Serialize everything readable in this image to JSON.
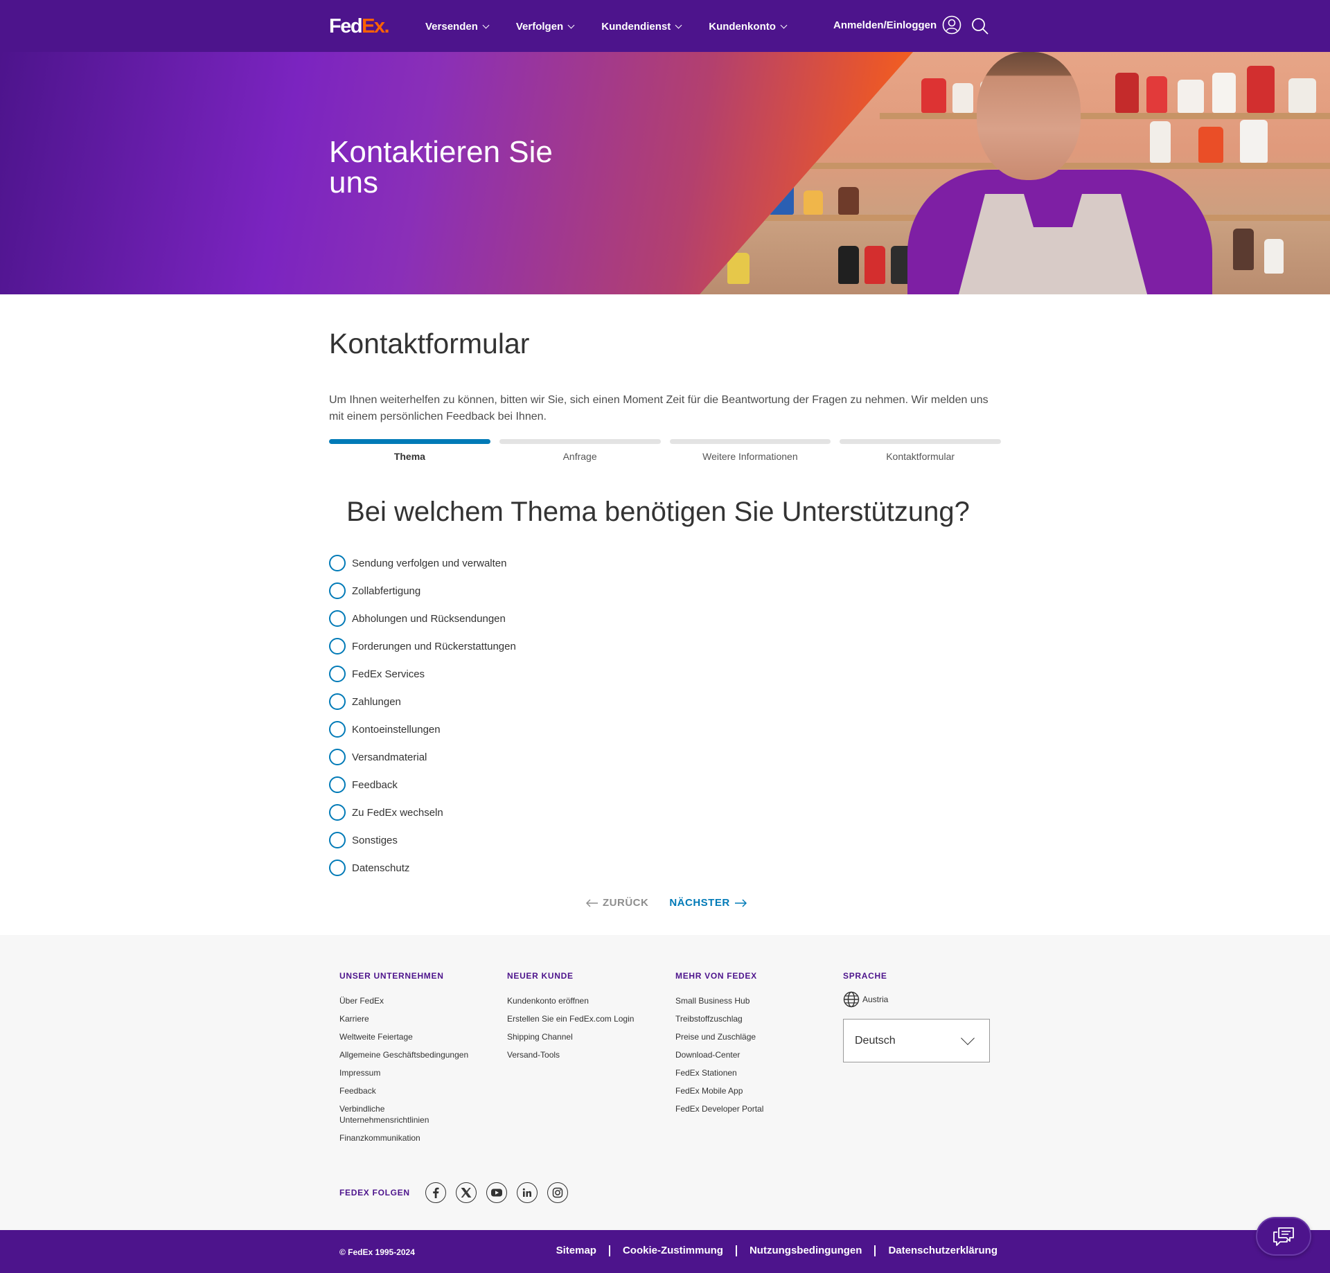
{
  "header": {
    "logo_fed": "Fed",
    "logo_ex": "Ex",
    "logo_dot": ".",
    "nav": [
      "Versenden",
      "Verfolgen",
      "Kundendienst",
      "Kundenkonto"
    ],
    "login_label": "Anmelden/Einloggen"
  },
  "hero": {
    "title": "Kontaktieren Sie uns"
  },
  "main": {
    "title": "Kontaktformular",
    "intro": "Um Ihnen weiterhelfen zu können, bitten wir Sie, sich einen Moment Zeit für die Beantwortung der Fragen zu nehmen. Wir melden uns mit einem persönlichen Feedback bei Ihnen.",
    "steps": [
      "Thema",
      "Anfrage",
      "Weitere Informationen",
      "Kontaktformular"
    ],
    "active_step": 0,
    "question": "Bei welchem Thema benötigen Sie Unterstützung?",
    "options": [
      "Sendung verfolgen und verwalten",
      "Zollabfertigung",
      "Abholungen und Rücksendungen",
      "Forderungen und Rückerstattungen",
      "FedEx Services",
      "Zahlungen",
      "Kontoeinstellungen",
      "Versandmaterial",
      "Feedback",
      "Zu FedEx wechseln",
      "Sonstiges",
      "Datenschutz"
    ],
    "back_label": "ZURÜCK",
    "next_label": "NÄCHSTER"
  },
  "footer": {
    "col1": {
      "heading": "UNSER UNTERNEHMEN",
      "links": [
        "Über FedEx",
        "Karriere",
        "Weltweite Feiertage",
        "Allgemeine Geschäftsbedingungen",
        "Impressum",
        "Feedback",
        "Verbindliche Unternehmensrichtlinien",
        "Finanzkommunikation"
      ]
    },
    "col2": {
      "heading": "NEUER KUNDE",
      "links": [
        "Kundenkonto eröffnen",
        "Erstellen Sie ein FedEx.com Login",
        "Shipping Channel",
        "Versand-Tools"
      ]
    },
    "col3": {
      "heading": "MEHR VON FEDEX",
      "links": [
        "Small Business Hub",
        "Treibstoffzuschlag",
        "Preise und Zuschläge",
        "Download-Center",
        "FedEx Stationen",
        "FedEx Mobile App",
        "FedEx Developer Portal"
      ]
    },
    "language": {
      "heading": "SPRACHE",
      "country": "Austria",
      "selected": "Deutsch"
    },
    "follow_label": "FEDEX FOLGEN",
    "social_icons": [
      "facebook-icon",
      "x-twitter-icon",
      "youtube-icon",
      "linkedin-icon",
      "instagram-icon"
    ]
  },
  "bottom": {
    "copyright": "© FedEx 1995-2024",
    "links": [
      "Sitemap",
      "Cookie-Zustimmung",
      "Nutzungsbedingungen",
      "Datenschutzerklärung"
    ]
  },
  "colors": {
    "brand_purple": "#4d148c",
    "brand_orange": "#ff6200",
    "accent_blue": "#007ab7"
  }
}
